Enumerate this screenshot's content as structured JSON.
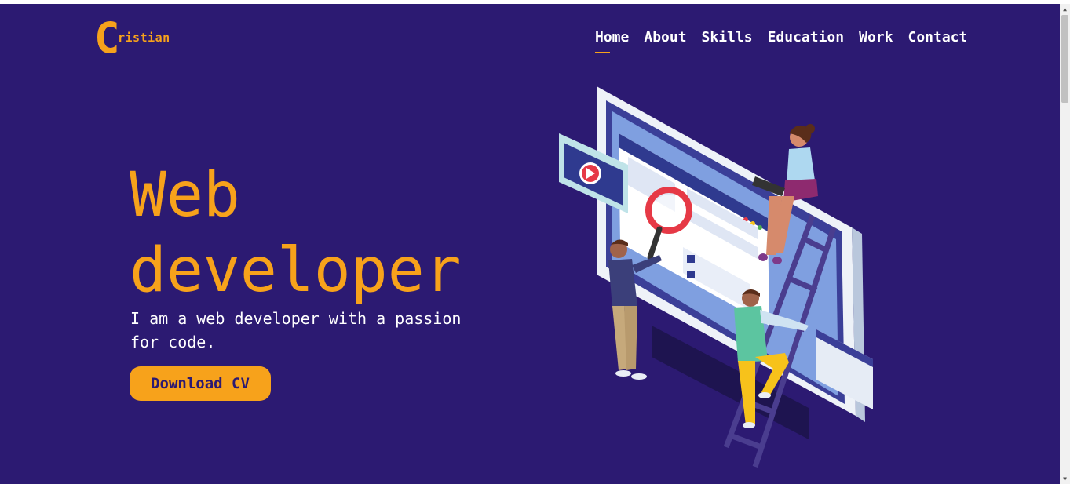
{
  "colors": {
    "background": "#2c1a72",
    "accent": "#f7a21b",
    "text": "#ffffff"
  },
  "logo": {
    "initial": "C",
    "rest": "ristian"
  },
  "nav": {
    "items": [
      {
        "label": "Home",
        "active": true
      },
      {
        "label": "About"
      },
      {
        "label": "Skills"
      },
      {
        "label": "Education"
      },
      {
        "label": "Work"
      },
      {
        "label": "Contact"
      }
    ]
  },
  "hero": {
    "title_line1": "Web",
    "title_line2": "developer",
    "subtitle": "I am a web developer with a passion for code.",
    "cta_label": "Download CV"
  },
  "illustration": {
    "icons": [
      "monitor-icon",
      "play-button-icon",
      "magnifier-icon",
      "ladder-icon"
    ]
  }
}
